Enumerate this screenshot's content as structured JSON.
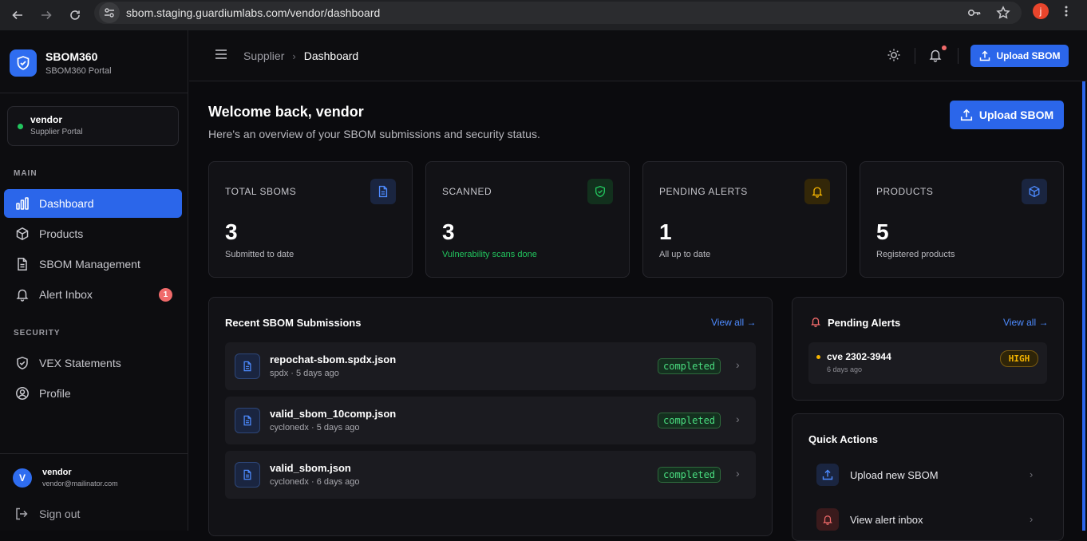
{
  "browser": {
    "url": "sbom.staging.guardiumlabs.com/vendor/dashboard",
    "profile_initial": "j"
  },
  "sidebar": {
    "brand_title": "SBOM360",
    "brand_subtitle": "SBOM360 Portal",
    "user_card": {
      "name": "vendor",
      "role": "Supplier Portal",
      "status_color": "#22c55e"
    },
    "sections": [
      {
        "label": "MAIN",
        "items": [
          {
            "label": "Dashboard",
            "icon": "bar-chart-icon",
            "active": true
          },
          {
            "label": "Products",
            "icon": "cube-icon"
          },
          {
            "label": "SBOM Management",
            "icon": "document-icon"
          },
          {
            "label": "Alert Inbox",
            "icon": "bell-icon",
            "badge": "1"
          }
        ]
      },
      {
        "label": "SECURITY",
        "items": [
          {
            "label": "VEX Statements",
            "icon": "shield-icon"
          },
          {
            "label": "Profile",
            "icon": "user-icon"
          }
        ]
      }
    ],
    "footer": {
      "avatar_initial": "V",
      "name": "vendor",
      "email": "vendor@mailinator.com",
      "signout": "Sign out"
    }
  },
  "header": {
    "breadcrumb": [
      "Supplier",
      "Dashboard"
    ],
    "upload_label": "Upload SBOM"
  },
  "main": {
    "welcome": "Welcome back, vendor",
    "subtitle": "Here's an overview of your SBOM submissions and security status.",
    "upload_label": "Upload SBOM",
    "stats": [
      {
        "label": "TOTAL SBOMS",
        "value": "3",
        "sub": "Submitted to date",
        "icon": "document-icon",
        "accent": "#4d8bff"
      },
      {
        "label": "SCANNED",
        "value": "3",
        "sub": "Vulnerability scans done",
        "icon": "shield-check-icon",
        "accent": "#22c55e"
      },
      {
        "label": "PENDING ALERTS",
        "value": "1",
        "sub": "All up to date",
        "icon": "bell-icon",
        "accent": "#f5b400"
      },
      {
        "label": "PRODUCTS",
        "value": "5",
        "sub": "Registered products",
        "icon": "cube-icon",
        "accent": "#4d8bff"
      }
    ],
    "recent": {
      "title": "Recent SBOM Submissions",
      "view_all": "View all →",
      "items": [
        {
          "name": "repochat-sbom.spdx.json",
          "meta": "spdx · 5 days ago",
          "status": "completed"
        },
        {
          "name": "valid_sbom_10comp.json",
          "meta": "cyclonedx · 5 days ago",
          "status": "completed"
        },
        {
          "name": "valid_sbom.json",
          "meta": "cyclonedx · 6 days ago",
          "status": "completed"
        }
      ]
    },
    "alerts": {
      "title": "Pending Alerts",
      "view_all": "View all →",
      "items": [
        {
          "name": "cve 2302-3944",
          "time": "6 days ago",
          "severity": "HIGH"
        }
      ]
    },
    "quick_actions": {
      "title": "Quick Actions",
      "items": [
        {
          "label": "Upload new SBOM",
          "icon": "upload-icon"
        },
        {
          "label": "View alert inbox",
          "icon": "bell-icon"
        }
      ]
    }
  }
}
